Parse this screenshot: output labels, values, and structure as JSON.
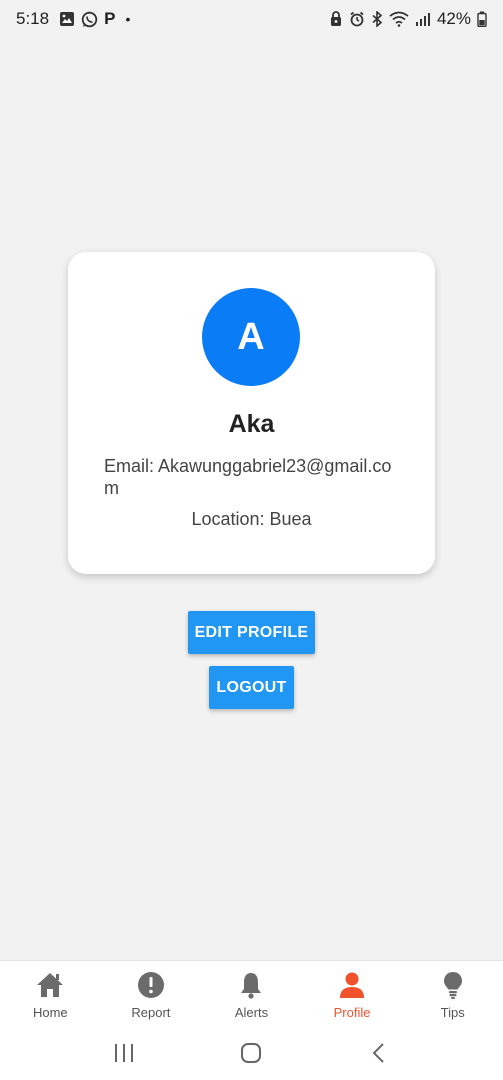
{
  "status_bar": {
    "time": "5:18",
    "letter": "P",
    "dot": "•",
    "battery": "42%",
    "icons": [
      "gallery-icon",
      "whatsapp-icon",
      "p-icon",
      "dot-icon",
      "lock-icon",
      "alarm-icon",
      "bluetooth-icon",
      "wifi-icon",
      "signal-icon",
      "battery-icon"
    ]
  },
  "profile": {
    "avatar_letter": "A",
    "name": "Aka",
    "email": "Email: Akawunggabriel23@gmail.com",
    "location": "Location: Buea",
    "avatar_color": "#0a7cf5"
  },
  "actions": {
    "edit_label": "EDIT PROFILE",
    "logout_label": "LOGOUT",
    "button_color": "#2196f3"
  },
  "bottom_nav": {
    "active": "Profile",
    "active_color": "#f0532b",
    "items": [
      {
        "label": "Home",
        "icon": "home-icon"
      },
      {
        "label": "Report",
        "icon": "alert-circle-icon"
      },
      {
        "label": "Alerts",
        "icon": "bell-icon"
      },
      {
        "label": "Profile",
        "icon": "person-icon"
      },
      {
        "label": "Tips",
        "icon": "lightbulb-icon"
      }
    ]
  },
  "system_nav": {
    "icons": [
      "recents-icon",
      "home-circle-icon",
      "back-icon"
    ]
  }
}
